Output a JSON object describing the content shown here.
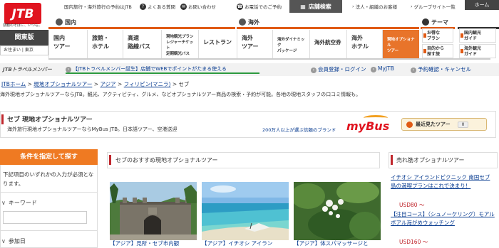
{
  "header": {
    "logo_text": "JTB",
    "logo_tagline": "感動のそばに、いつも。",
    "util_links": [
      {
        "label": "国内旅行・海外旅行の予約はJTB"
      },
      {
        "label": "よくある質問"
      },
      {
        "label": "お問い合わせ"
      },
      {
        "label": "お電話でのご予約"
      }
    ],
    "store_search": "店舗検索",
    "corp_link": "法人・組織のお客様",
    "group_link": "グループサイト一覧",
    "home": "ホーム"
  },
  "region": {
    "name": "関東版",
    "sub_label": "お住まい",
    "sub_value": "東京"
  },
  "nav": {
    "domestic_label": "国内",
    "overseas_label": "海外",
    "theme_label": "テーマ",
    "domestic_items": [
      "国内\nツアー",
      "旅館・\nホテル",
      "高速\n路線バス",
      "現地観光プラン\nレジャーチケット\n定期観光バス",
      "レストラン"
    ],
    "overseas_items": [
      "海外\nツアー",
      "海外ダイナミック\nパッケージ",
      "海外航空券",
      "海外\nホテル",
      "現地オプショナル\nツアー"
    ],
    "theme_items": [
      "お得な\nプラン",
      "目的から\n探す旅"
    ],
    "guide_items": [
      "国内観光\nガイド",
      "海外観光\nガイド"
    ],
    "colors": {
      "accent": "#e8742a",
      "line": "#e05a14"
    }
  },
  "member_bar": {
    "brand": "JTBトラベルメンバー",
    "promo": "【JTBトラベルメンバー誕生】店舗でWEBでポイントがたまる使える",
    "login": "会員登録・ログイン",
    "myjtb": "MyJTB",
    "reservation": "予約確認・キャンセル"
  },
  "breadcrumb": {
    "items": [
      "JTBホーム",
      "現地オプショナルツアー",
      "アジア",
      "フィリピン(マニラ)"
    ],
    "current": "セブ",
    "sep": ">"
  },
  "intro_text": "海外現地オプショナルツアーならJTB。観光、アクティビティ、グルメ、などオプショナルツアー商品の検索・予約が可能。各地の現地スタッフの口コミ情報も。",
  "title_box": {
    "title": "セブ 現地オプショナルツアー",
    "subtitle": "海外旅行現地オプショナルツアーならMyBus JTB。日本語ツアー、空港送迎",
    "brand_tag": "200万人以上が選ぶ信頼のブランド",
    "mybus": "myBus",
    "recent_label": "最近見たツアー",
    "recent_count": "0"
  },
  "search_panel": {
    "header": "条件を指定して探す",
    "note": "下記項目のいずれかの入力が必須となります。",
    "keyword_label": "キーワード",
    "keyword_value": "",
    "date_label": "参加日"
  },
  "recommended": {
    "title": "セブのおすすめ現地オプショナルツアー",
    "captions": [
      "【アジア】見所・セブ市内観",
      "【アジア】イチオシ アイラン",
      "【アジア】体スパマッサージと"
    ]
  },
  "best_sellers": {
    "title": "売れ筋オプショナルツアー",
    "items": [
      {
        "label": "イチオシ アイランドピクニック 南国セブ島の満喫プランはこれで決まり！",
        "price": "USD80 〜"
      },
      {
        "label": "【注目コース】（シュノーケリング）モアルボアル海がめウォッチング",
        "price": "USD160 〜"
      }
    ]
  }
}
